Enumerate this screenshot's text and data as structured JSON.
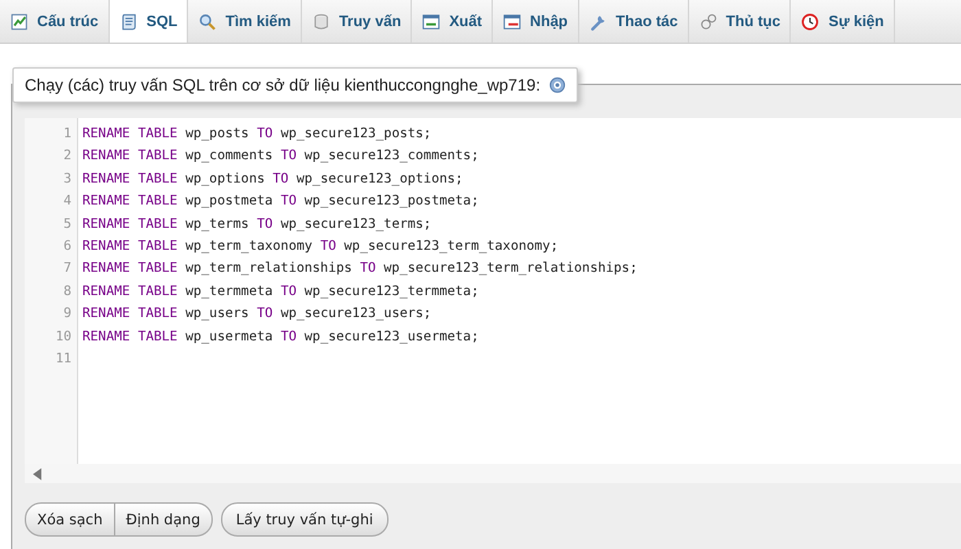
{
  "tabs": [
    {
      "label": "Cấu trúc",
      "kind": "structure",
      "selected": false
    },
    {
      "label": "SQL",
      "kind": "sql",
      "selected": true
    },
    {
      "label": "Tìm kiếm",
      "kind": "search",
      "selected": false
    },
    {
      "label": "Truy vấn",
      "kind": "query",
      "selected": false
    },
    {
      "label": "Xuất",
      "kind": "export",
      "selected": false
    },
    {
      "label": "Nhập",
      "kind": "import",
      "selected": false
    },
    {
      "label": "Thao tác",
      "kind": "operations",
      "selected": false
    },
    {
      "label": "Thủ tục",
      "kind": "routines",
      "selected": false
    },
    {
      "label": "Sự kiện",
      "kind": "events",
      "selected": false
    }
  ],
  "fieldset": {
    "legend": "Chạy (các) truy vấn SQL trên cơ sở dữ liệu kienthuccongnghe_wp719:"
  },
  "editor": {
    "lines": [
      {
        "number": "1",
        "tokens": [
          {
            "text": "RENAME",
            "kind": "keyword"
          },
          {
            "text": "TABLE",
            "kind": "keyword"
          },
          {
            "text": "wp_posts",
            "kind": "name"
          },
          {
            "text": "TO",
            "kind": "keyword"
          },
          {
            "text": "wp_secure123_posts;",
            "kind": "name"
          }
        ]
      },
      {
        "number": "2",
        "tokens": [
          {
            "text": "RENAME",
            "kind": "keyword"
          },
          {
            "text": "TABLE",
            "kind": "keyword"
          },
          {
            "text": "wp_comments",
            "kind": "name"
          },
          {
            "text": "TO",
            "kind": "keyword"
          },
          {
            "text": "wp_secure123_comments;",
            "kind": "name"
          }
        ]
      },
      {
        "number": "3",
        "tokens": [
          {
            "text": "RENAME",
            "kind": "keyword"
          },
          {
            "text": "TABLE",
            "kind": "keyword"
          },
          {
            "text": "wp_options",
            "kind": "name"
          },
          {
            "text": "TO",
            "kind": "keyword"
          },
          {
            "text": "wp_secure123_options;",
            "kind": "name"
          }
        ]
      },
      {
        "number": "4",
        "tokens": [
          {
            "text": "RENAME",
            "kind": "keyword"
          },
          {
            "text": "TABLE",
            "kind": "keyword"
          },
          {
            "text": "wp_postmeta",
            "kind": "name"
          },
          {
            "text": "TO",
            "kind": "keyword"
          },
          {
            "text": "wp_secure123_postmeta;",
            "kind": "name"
          }
        ]
      },
      {
        "number": "5",
        "tokens": [
          {
            "text": "RENAME",
            "kind": "keyword"
          },
          {
            "text": "TABLE",
            "kind": "keyword"
          },
          {
            "text": "wp_terms",
            "kind": "name"
          },
          {
            "text": "TO",
            "kind": "keyword"
          },
          {
            "text": "wp_secure123_terms;",
            "kind": "name"
          }
        ]
      },
      {
        "number": "6",
        "tokens": [
          {
            "text": "RENAME",
            "kind": "keyword"
          },
          {
            "text": "TABLE",
            "kind": "keyword"
          },
          {
            "text": "wp_term_taxonomy",
            "kind": "name"
          },
          {
            "text": "TO",
            "kind": "keyword"
          },
          {
            "text": "wp_secure123_term_taxonomy;",
            "kind": "name"
          }
        ]
      },
      {
        "number": "7",
        "tokens": [
          {
            "text": "RENAME",
            "kind": "keyword"
          },
          {
            "text": "TABLE",
            "kind": "keyword"
          },
          {
            "text": "wp_term_relationships",
            "kind": "name"
          },
          {
            "text": "TO",
            "kind": "keyword"
          },
          {
            "text": "wp_secure123_term_relationships;",
            "kind": "name"
          }
        ]
      },
      {
        "number": "8",
        "tokens": [
          {
            "text": "RENAME",
            "kind": "keyword"
          },
          {
            "text": "TABLE",
            "kind": "keyword"
          },
          {
            "text": "wp_termmeta",
            "kind": "name"
          },
          {
            "text": "TO",
            "kind": "keyword"
          },
          {
            "text": "wp_secure123_termmeta;",
            "kind": "name"
          }
        ]
      },
      {
        "number": "9",
        "tokens": [
          {
            "text": "RENAME",
            "kind": "keyword"
          },
          {
            "text": "TABLE",
            "kind": "keyword"
          },
          {
            "text": "wp_users",
            "kind": "name"
          },
          {
            "text": "TO",
            "kind": "keyword"
          },
          {
            "text": "wp_secure123_users;",
            "kind": "name"
          }
        ]
      },
      {
        "number": "10",
        "tokens": [
          {
            "text": "RENAME",
            "kind": "keyword"
          },
          {
            "text": "TABLE",
            "kind": "keyword"
          },
          {
            "text": "wp_usermeta",
            "kind": "name"
          },
          {
            "text": "TO",
            "kind": "keyword"
          },
          {
            "text": "wp_secure123_usermeta;",
            "kind": "name"
          }
        ]
      },
      {
        "number": "11"
      }
    ]
  },
  "button_group": [
    "Xóa sạch",
    "Định dạng"
  ],
  "buttons": [
    "Lấy truy vấn tự-ghi"
  ]
}
